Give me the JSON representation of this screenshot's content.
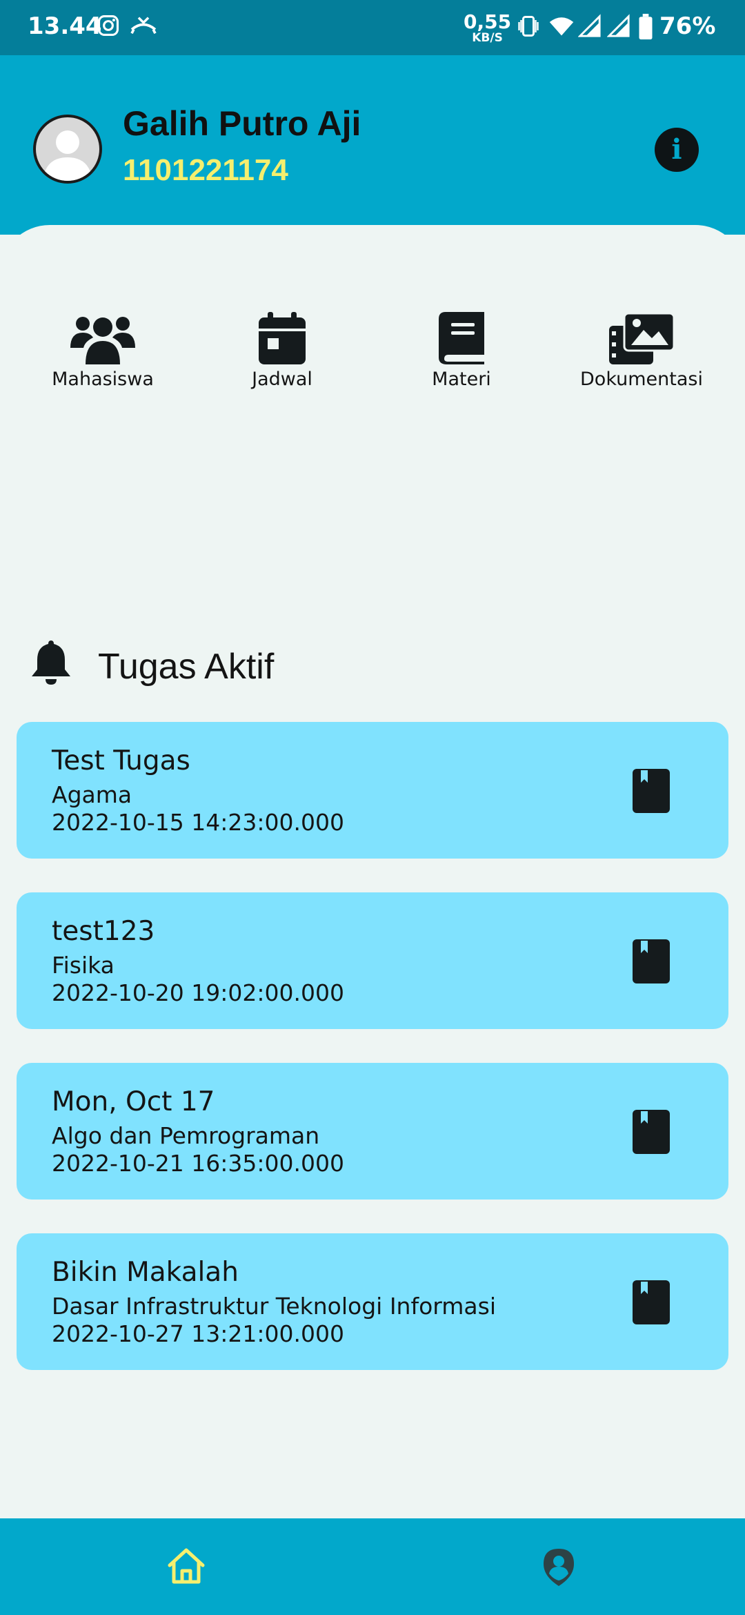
{
  "status_bar": {
    "time": "13.44",
    "net_speed": "0,55",
    "net_unit": "KB/S",
    "battery": "76%"
  },
  "profile": {
    "name": "Galih Putro Aji",
    "nim": "1101221174",
    "info_icon": "i"
  },
  "menu": [
    {
      "label": "Mahasiswa",
      "icon": "users-icon"
    },
    {
      "label": "Jadwal",
      "icon": "calendar-icon"
    },
    {
      "label": "Materi",
      "icon": "book-icon"
    },
    {
      "label": "Dokumentasi",
      "icon": "images-icon"
    }
  ],
  "active_tasks": {
    "title": "Tugas Aktif",
    "items": [
      {
        "title": "Test Tugas",
        "subject": "Agama",
        "deadline": "2022-10-15 14:23:00.000"
      },
      {
        "title": "test123",
        "subject": "Fisika",
        "deadline": "2022-10-20 19:02:00.000"
      },
      {
        "title": "Mon, Oct 17",
        "subject": "Algo dan Pemrograman",
        "deadline": "2022-10-21 16:35:00.000"
      },
      {
        "title": "Bikin Makalah",
        "subject": "Dasar Infrastruktur Teknologi Informasi",
        "deadline": "2022-10-27 13:21:00.000"
      }
    ]
  },
  "bottom_nav": [
    {
      "icon": "home-icon",
      "active": true
    },
    {
      "icon": "profile-icon",
      "active": false
    }
  ],
  "colors": {
    "header": "#02a8cb",
    "status_bar": "#047e9a",
    "card": "#80e2fe",
    "accent_yellow": "#f6ef6e",
    "background": "#eef5f3"
  }
}
